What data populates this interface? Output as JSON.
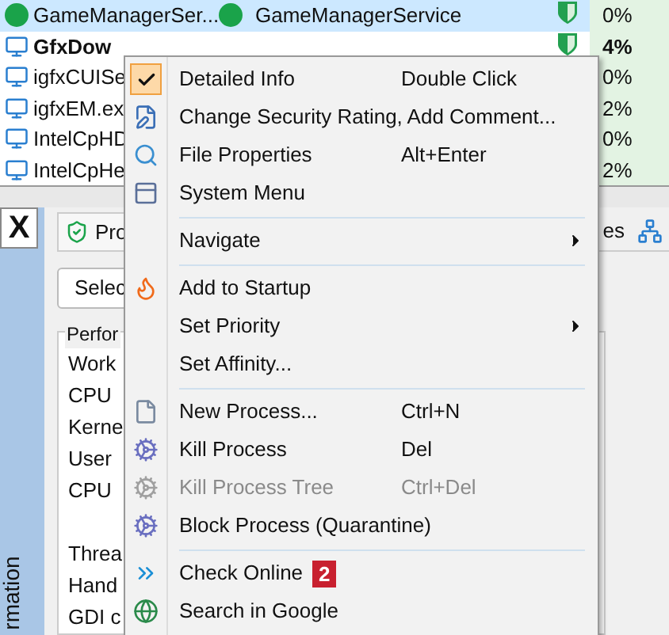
{
  "processes": [
    {
      "name": "GameManagerSer...",
      "description": "GameManagerService",
      "cpu": "0%",
      "bold": false,
      "selected": true
    },
    {
      "name": "GfxDow",
      "cpu": "4%",
      "bold": true,
      "selected": false
    },
    {
      "name": "igfxCUISe",
      "cpu": "0%",
      "bold": false,
      "selected": false
    },
    {
      "name": "igfxEM.ex",
      "cpu": "2%",
      "bold": false,
      "selected": false
    },
    {
      "name": "IntelCpHD",
      "cpu": "0%",
      "bold": false,
      "selected": false
    },
    {
      "name": "IntelCpHe",
      "cpu": "2%",
      "bold": false,
      "selected": false
    }
  ],
  "close_button": "X",
  "tabs": [
    {
      "label": "Pro",
      "selected": true
    },
    {
      "label": "es",
      "selected": false
    }
  ],
  "select_button": "Selec",
  "performance_group": {
    "title": "Perfor",
    "rows": [
      "Work",
      "CPU",
      "Kerne",
      "User",
      "CPU",
      "",
      "Threa",
      "Hand",
      "GDI c"
    ]
  },
  "side_label": "rmation",
  "context_menu": [
    {
      "kind": "item",
      "label": "Detailed Info",
      "shortcut": "Double Click",
      "checked": true
    },
    {
      "kind": "item",
      "label": "Change Security Rating, Add Comment...",
      "checked": false
    },
    {
      "kind": "item",
      "label": "File Properties",
      "shortcut": "Alt+Enter",
      "checked": false
    },
    {
      "kind": "item",
      "label": "System Menu",
      "checked": false
    },
    {
      "kind": "separator"
    },
    {
      "kind": "submenu",
      "label": "Navigate"
    },
    {
      "kind": "separator"
    },
    {
      "kind": "item",
      "label": "Add to Startup",
      "checked": false
    },
    {
      "kind": "submenu",
      "label": "Set Priority"
    },
    {
      "kind": "item",
      "label": "Set Affinity...",
      "checked": false
    },
    {
      "kind": "separator"
    },
    {
      "kind": "item",
      "label": "New Process...",
      "shortcut": "Ctrl+N",
      "checked": false
    },
    {
      "kind": "item",
      "label": "Kill Process",
      "shortcut": "Del",
      "checked": false
    },
    {
      "kind": "item",
      "label": "Kill Process Tree",
      "shortcut": "Ctrl+Del",
      "checked": false,
      "disabled": true
    },
    {
      "kind": "item",
      "label": "Block Process (Quarantine)",
      "checked": false
    },
    {
      "kind": "separator"
    },
    {
      "kind": "item",
      "label": "Check Online",
      "checked": false,
      "badge": "2"
    },
    {
      "kind": "item",
      "label": "Search in Google",
      "checked": false
    }
  ]
}
